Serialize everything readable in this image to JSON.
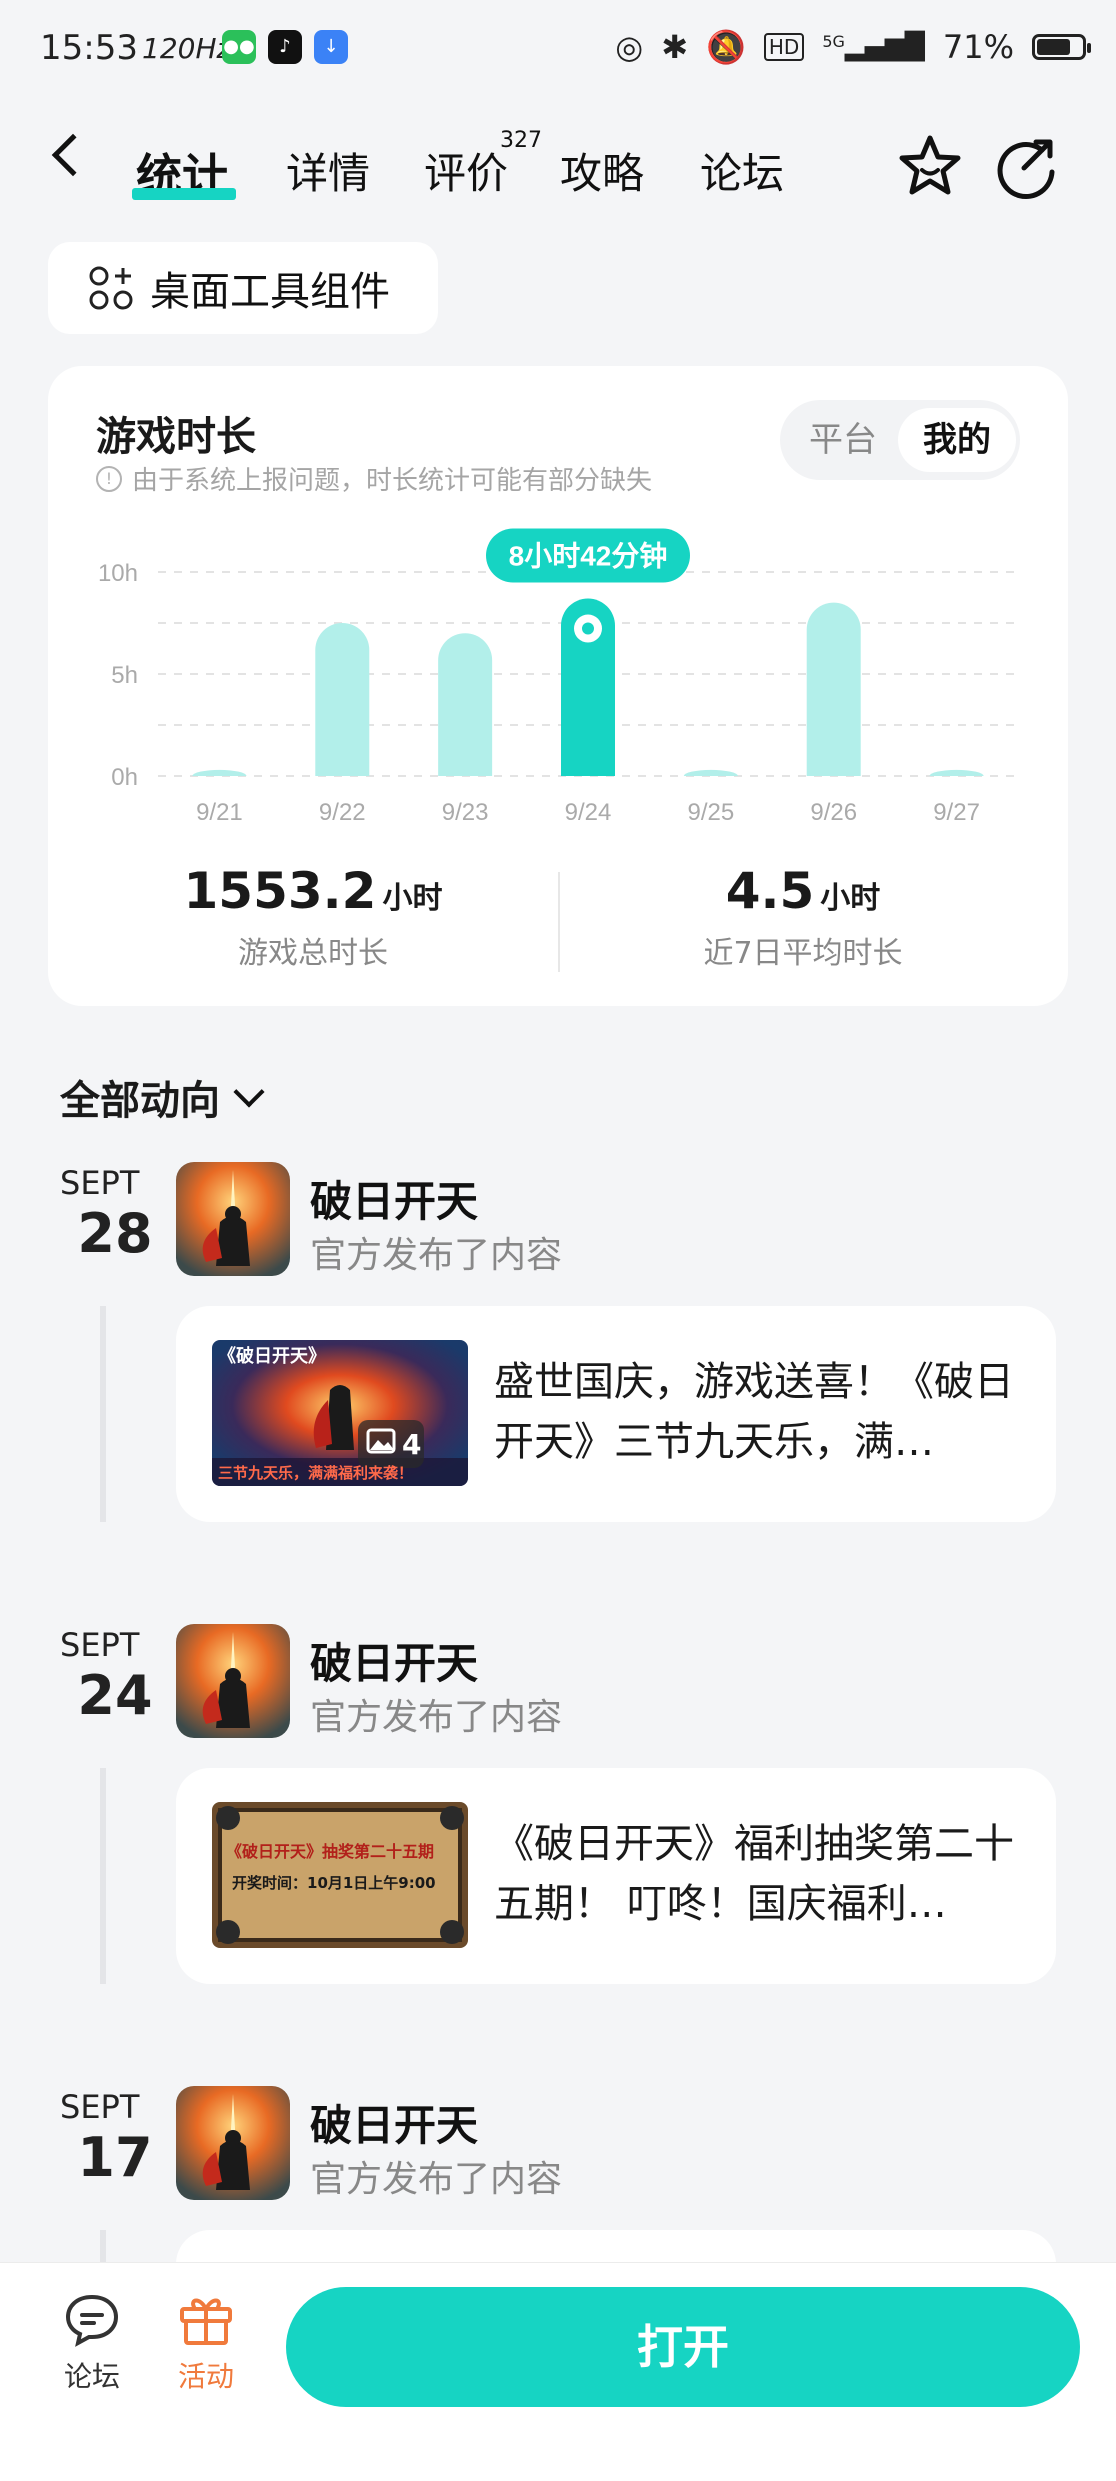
{
  "status_bar": {
    "time": "15:53",
    "refresh": "120Hz",
    "hd": "HD",
    "network": "5G",
    "battery": "71%"
  },
  "nav": {
    "tabs": [
      {
        "label": "统计",
        "active": true
      },
      {
        "label": "详情"
      },
      {
        "label": "评价",
        "badge": "327"
      },
      {
        "label": "攻略"
      },
      {
        "label": "论坛"
      }
    ]
  },
  "widget_button": {
    "label": "桌面工具组件"
  },
  "stats": {
    "title": "游戏时长",
    "note": "由于系统上报问题，时长统计可能有部分缺失",
    "toggle": [
      "平台",
      "我的"
    ],
    "total_value": "1553.2",
    "total_unit": "小时",
    "total_label": "游戏总时长",
    "avg_value": "4.5",
    "avg_unit": "小时",
    "avg_label": "近7日平均时长"
  },
  "chart_data": {
    "type": "bar",
    "categories": [
      "9/21",
      "9/22",
      "9/23",
      "9/24",
      "9/25",
      "9/26",
      "9/27"
    ],
    "values": [
      0.3,
      7.5,
      7.0,
      8.7,
      0.3,
      8.5,
      0.3
    ],
    "ylim": [
      0,
      10
    ],
    "yticks": [
      "0h",
      "5h",
      "10h"
    ],
    "highlight_index": 3,
    "tooltip": "8小时42分钟",
    "colors": {
      "highlight": "#16d4c3",
      "normal": "#b2efea"
    },
    "grid": true
  },
  "activity": {
    "header": "全部动向",
    "posts": [
      {
        "month": "SEPT",
        "day": "28",
        "name": "破日开天",
        "sub": "官方发布了内容",
        "text": "盛世国庆，游戏送喜！《破日开天》三节九天乐，满…",
        "thumb_title": "《破日开天》",
        "thumb_caption": "三节九天乐，满满福利来袭！",
        "image_count": "4"
      },
      {
        "month": "SEPT",
        "day": "24",
        "name": "破日开天",
        "sub": "官方发布了内容",
        "text": "《破日开天》福利抽奖第二十五期！ 叮咚！国庆福利…",
        "thumb_title": "《破日开天》抽奖第二十五期",
        "thumb_caption": "开奖时间：10月1日上午9:00"
      },
      {
        "month": "SEPT",
        "day": "17",
        "name": "破日开天",
        "sub": "官方发布了内容"
      }
    ]
  },
  "bottom_bar": {
    "forum": "论坛",
    "activity": "活动",
    "open": "打开"
  }
}
